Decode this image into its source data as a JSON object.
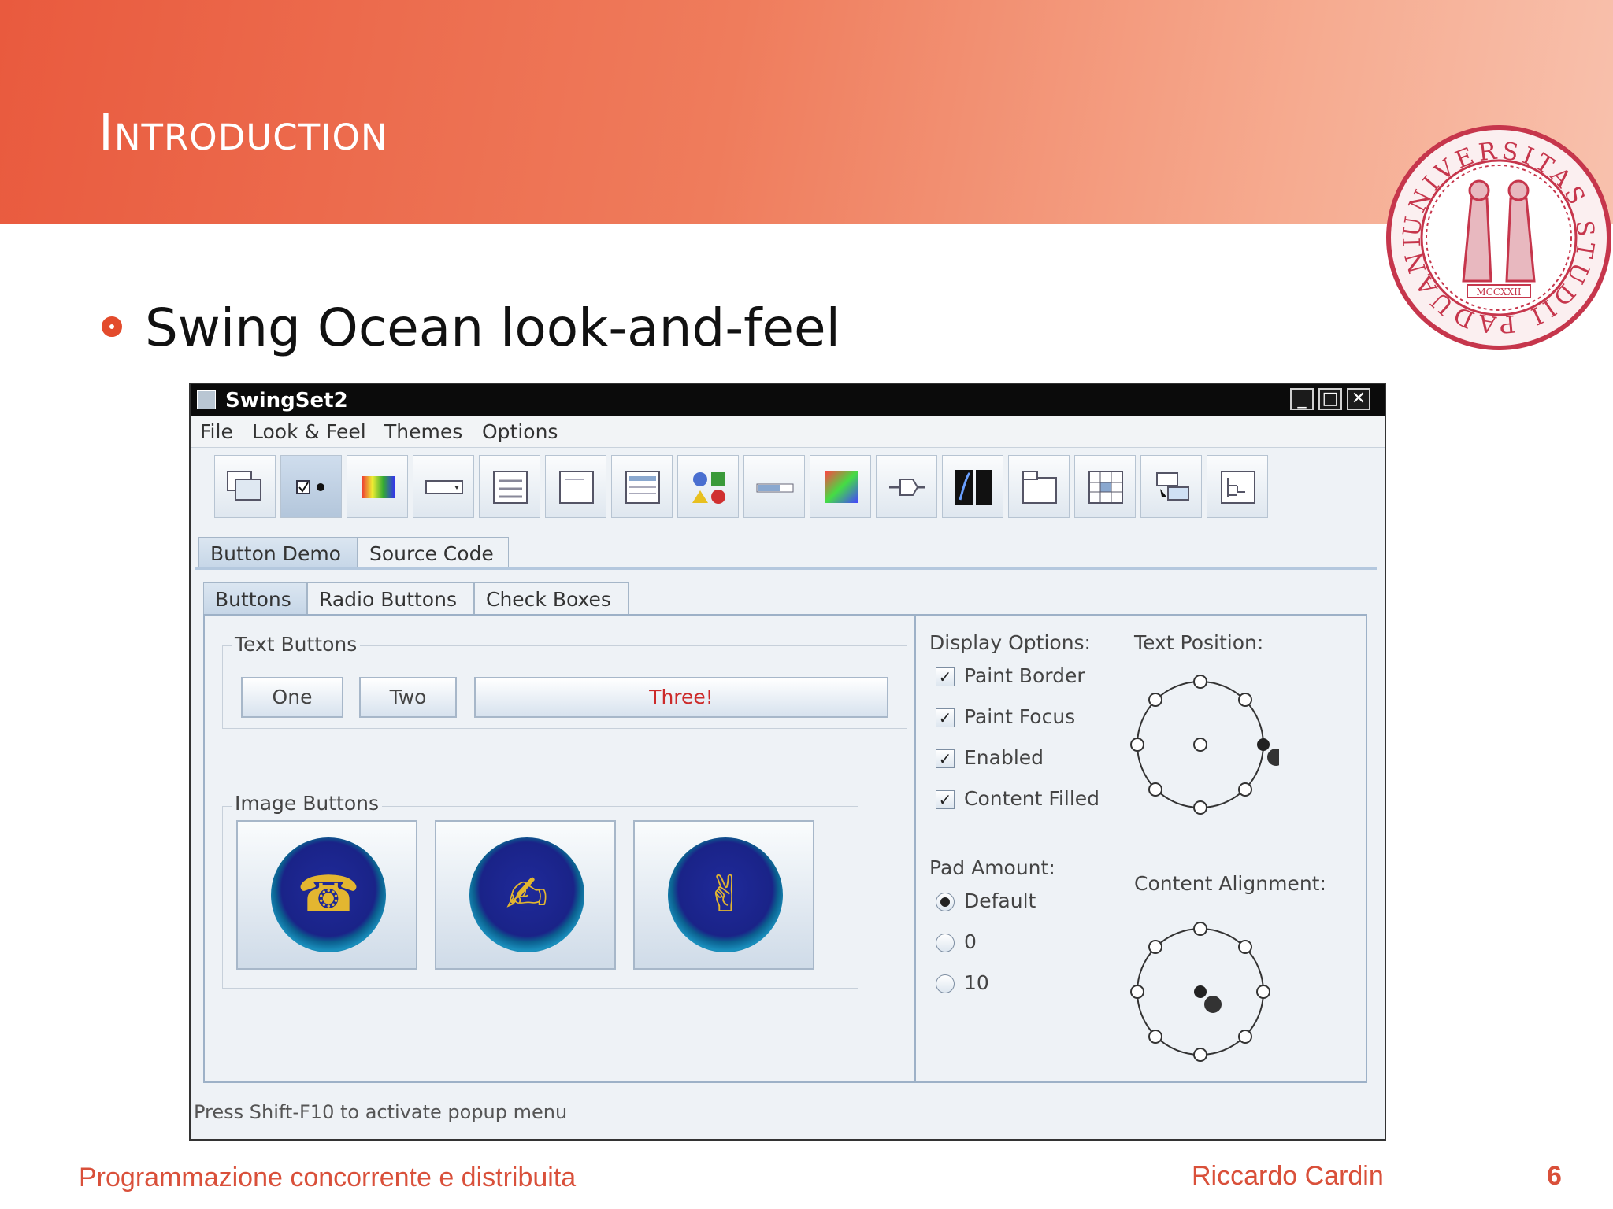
{
  "slide": {
    "title": "Introduction",
    "bullet": "Swing Ocean look-and-feel",
    "footer_course": "Programmazione concorrente e distribuita",
    "footer_author": "Riccardo Cardin",
    "page_number": "6",
    "accent_color": "#e34b2c",
    "seal": {
      "legend_top": "UNIVERSITAS STUDII PADUANI",
      "year": "MCCXXII"
    }
  },
  "window": {
    "title": "SwingSet2",
    "controls": [
      "minimize-icon",
      "maximize-icon",
      "close-icon"
    ],
    "menu": [
      "File",
      "Look & Feel",
      "Themes",
      "Options"
    ],
    "toolbar_icons": [
      "internal-frame-icon",
      "button-demo-icon",
      "color-chooser-icon",
      "combobox-icon",
      "file-chooser-icon",
      "editor-pane-icon",
      "list-icon",
      "option-pane-icon",
      "progress-bar-icon",
      "scroll-pane-icon",
      "slider-icon",
      "split-pane-icon",
      "tabbed-pane-icon",
      "table-icon",
      "tooltip-icon",
      "tree-icon"
    ],
    "outer_tabs": [
      "Button Demo",
      "Source Code"
    ],
    "inner_tabs": [
      "Buttons",
      "Radio Buttons",
      "Check Boxes"
    ],
    "text_buttons": {
      "label": "Text Buttons",
      "one": "One",
      "two": "Two",
      "three": "Three!"
    },
    "image_buttons": {
      "label": "Image Buttons",
      "icons": [
        "telephone-icon",
        "pen-hand-icon",
        "peace-hand-icon"
      ]
    },
    "display_options": {
      "label": "Display Options:",
      "items": [
        {
          "label": "Paint Border",
          "checked": true
        },
        {
          "label": "Paint Focus",
          "checked": true
        },
        {
          "label": "Enabled",
          "checked": true
        },
        {
          "label": "Content Filled",
          "checked": true
        }
      ]
    },
    "pad_amount": {
      "label": "Pad Amount:",
      "items": [
        {
          "label": "Default",
          "selected": true
        },
        {
          "label": "0",
          "selected": false
        },
        {
          "label": "10",
          "selected": false
        }
      ]
    },
    "text_position_label": "Text Position:",
    "content_alignment_label": "Content Alignment:",
    "status": "Press Shift-F10 to activate popup menu"
  }
}
